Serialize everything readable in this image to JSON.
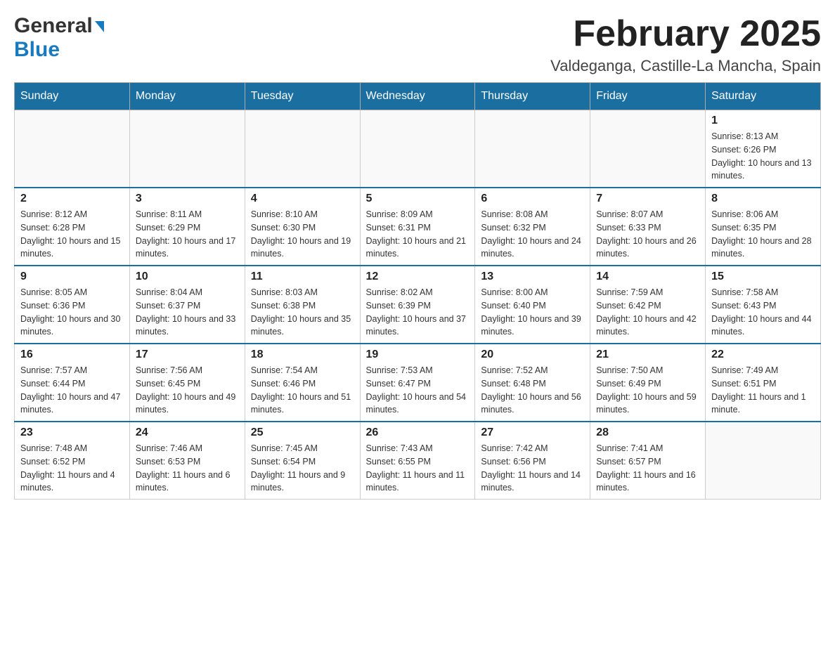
{
  "header": {
    "logo_text1": "General",
    "logo_text2": "Blue",
    "title": "February 2025",
    "subtitle": "Valdeganga, Castille-La Mancha, Spain"
  },
  "days_of_week": [
    "Sunday",
    "Monday",
    "Tuesday",
    "Wednesday",
    "Thursday",
    "Friday",
    "Saturday"
  ],
  "weeks": [
    [
      {
        "day": "",
        "info": ""
      },
      {
        "day": "",
        "info": ""
      },
      {
        "day": "",
        "info": ""
      },
      {
        "day": "",
        "info": ""
      },
      {
        "day": "",
        "info": ""
      },
      {
        "day": "",
        "info": ""
      },
      {
        "day": "1",
        "info": "Sunrise: 8:13 AM\nSunset: 6:26 PM\nDaylight: 10 hours and 13 minutes."
      }
    ],
    [
      {
        "day": "2",
        "info": "Sunrise: 8:12 AM\nSunset: 6:28 PM\nDaylight: 10 hours and 15 minutes."
      },
      {
        "day": "3",
        "info": "Sunrise: 8:11 AM\nSunset: 6:29 PM\nDaylight: 10 hours and 17 minutes."
      },
      {
        "day": "4",
        "info": "Sunrise: 8:10 AM\nSunset: 6:30 PM\nDaylight: 10 hours and 19 minutes."
      },
      {
        "day": "5",
        "info": "Sunrise: 8:09 AM\nSunset: 6:31 PM\nDaylight: 10 hours and 21 minutes."
      },
      {
        "day": "6",
        "info": "Sunrise: 8:08 AM\nSunset: 6:32 PM\nDaylight: 10 hours and 24 minutes."
      },
      {
        "day": "7",
        "info": "Sunrise: 8:07 AM\nSunset: 6:33 PM\nDaylight: 10 hours and 26 minutes."
      },
      {
        "day": "8",
        "info": "Sunrise: 8:06 AM\nSunset: 6:35 PM\nDaylight: 10 hours and 28 minutes."
      }
    ],
    [
      {
        "day": "9",
        "info": "Sunrise: 8:05 AM\nSunset: 6:36 PM\nDaylight: 10 hours and 30 minutes."
      },
      {
        "day": "10",
        "info": "Sunrise: 8:04 AM\nSunset: 6:37 PM\nDaylight: 10 hours and 33 minutes."
      },
      {
        "day": "11",
        "info": "Sunrise: 8:03 AM\nSunset: 6:38 PM\nDaylight: 10 hours and 35 minutes."
      },
      {
        "day": "12",
        "info": "Sunrise: 8:02 AM\nSunset: 6:39 PM\nDaylight: 10 hours and 37 minutes."
      },
      {
        "day": "13",
        "info": "Sunrise: 8:00 AM\nSunset: 6:40 PM\nDaylight: 10 hours and 39 minutes."
      },
      {
        "day": "14",
        "info": "Sunrise: 7:59 AM\nSunset: 6:42 PM\nDaylight: 10 hours and 42 minutes."
      },
      {
        "day": "15",
        "info": "Sunrise: 7:58 AM\nSunset: 6:43 PM\nDaylight: 10 hours and 44 minutes."
      }
    ],
    [
      {
        "day": "16",
        "info": "Sunrise: 7:57 AM\nSunset: 6:44 PM\nDaylight: 10 hours and 47 minutes."
      },
      {
        "day": "17",
        "info": "Sunrise: 7:56 AM\nSunset: 6:45 PM\nDaylight: 10 hours and 49 minutes."
      },
      {
        "day": "18",
        "info": "Sunrise: 7:54 AM\nSunset: 6:46 PM\nDaylight: 10 hours and 51 minutes."
      },
      {
        "day": "19",
        "info": "Sunrise: 7:53 AM\nSunset: 6:47 PM\nDaylight: 10 hours and 54 minutes."
      },
      {
        "day": "20",
        "info": "Sunrise: 7:52 AM\nSunset: 6:48 PM\nDaylight: 10 hours and 56 minutes."
      },
      {
        "day": "21",
        "info": "Sunrise: 7:50 AM\nSunset: 6:49 PM\nDaylight: 10 hours and 59 minutes."
      },
      {
        "day": "22",
        "info": "Sunrise: 7:49 AM\nSunset: 6:51 PM\nDaylight: 11 hours and 1 minute."
      }
    ],
    [
      {
        "day": "23",
        "info": "Sunrise: 7:48 AM\nSunset: 6:52 PM\nDaylight: 11 hours and 4 minutes."
      },
      {
        "day": "24",
        "info": "Sunrise: 7:46 AM\nSunset: 6:53 PM\nDaylight: 11 hours and 6 minutes."
      },
      {
        "day": "25",
        "info": "Sunrise: 7:45 AM\nSunset: 6:54 PM\nDaylight: 11 hours and 9 minutes."
      },
      {
        "day": "26",
        "info": "Sunrise: 7:43 AM\nSunset: 6:55 PM\nDaylight: 11 hours and 11 minutes."
      },
      {
        "day": "27",
        "info": "Sunrise: 7:42 AM\nSunset: 6:56 PM\nDaylight: 11 hours and 14 minutes."
      },
      {
        "day": "28",
        "info": "Sunrise: 7:41 AM\nSunset: 6:57 PM\nDaylight: 11 hours and 16 minutes."
      },
      {
        "day": "",
        "info": ""
      }
    ]
  ]
}
